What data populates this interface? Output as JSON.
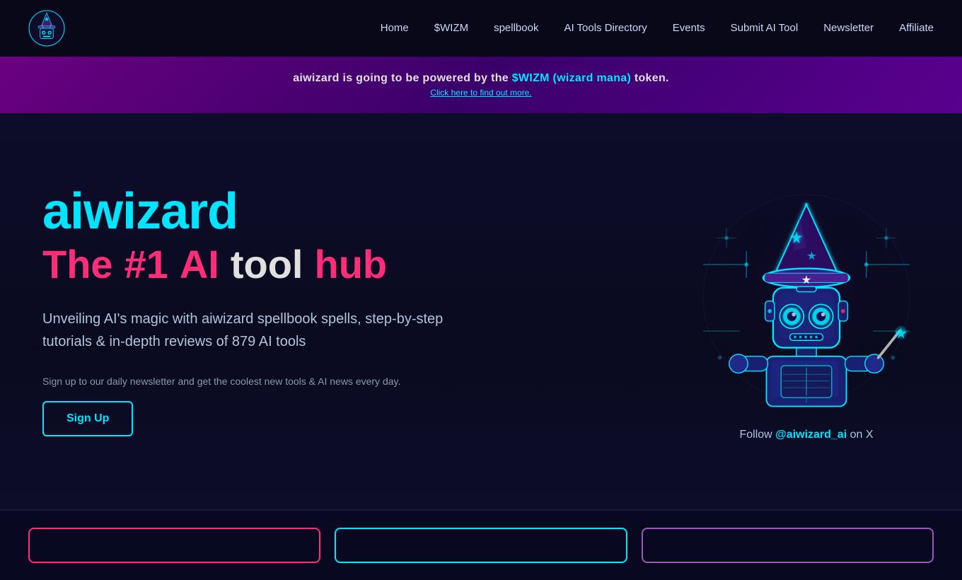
{
  "nav": {
    "logo_alt": "aiwizard logo",
    "links": [
      {
        "label": "Home",
        "href": "#"
      },
      {
        "label": "$WIZM",
        "href": "#"
      },
      {
        "label": "spellbook",
        "href": "#"
      },
      {
        "label": "AI Tools Directory",
        "href": "#"
      },
      {
        "label": "Events",
        "href": "#"
      },
      {
        "label": "Submit AI Tool",
        "href": "#"
      },
      {
        "label": "Newsletter",
        "href": "#"
      },
      {
        "label": "Affiliate",
        "href": "#"
      }
    ]
  },
  "banner": {
    "text_before": "aiwizard is going to be powered by the ",
    "highlight": "$WIZM (wizard mana)",
    "text_after": " token.",
    "sub": "Click here to find out more."
  },
  "hero": {
    "title": "aiwizard",
    "subtitle_the": "The",
    "subtitle_num": "#1",
    "subtitle_ai": "AI",
    "subtitle_tool": "tool",
    "subtitle_hub": "hub",
    "description": "Unveiling AI's magic with aiwizard spellbook spells, step-by-step tutorials & in-depth reviews of 879 AI tools",
    "newsletter_text": "Sign up to our daily newsletter and get the coolest new tools & AI news every day.",
    "signup_btn": "Sign Up",
    "follow_prefix": "Follow ",
    "follow_handle": "@aiwizard_ai",
    "follow_suffix": " on X"
  },
  "bottom_cards": [
    {
      "color": "pink"
    },
    {
      "color": "cyan"
    },
    {
      "color": "purple"
    }
  ]
}
